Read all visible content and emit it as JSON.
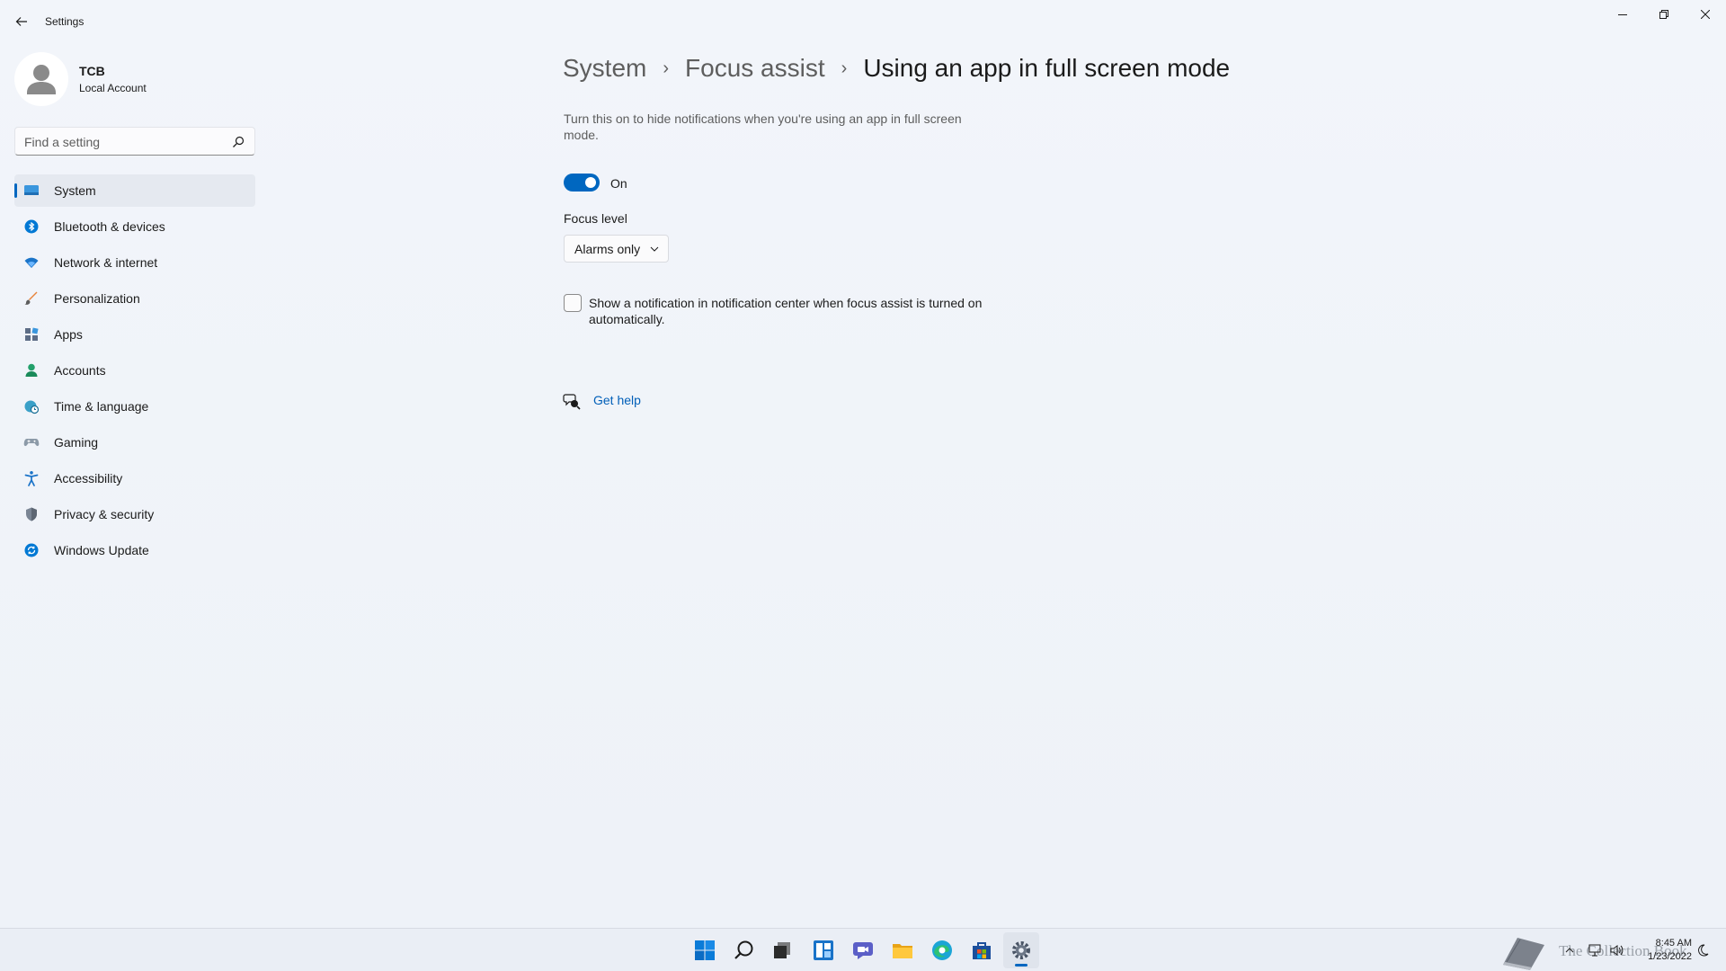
{
  "window": {
    "title": "Settings"
  },
  "profile": {
    "name": "TCB",
    "account_type": "Local Account"
  },
  "search": {
    "placeholder": "Find a setting"
  },
  "sidebar": {
    "items": [
      {
        "label": "System",
        "icon": "monitor-icon",
        "active": true
      },
      {
        "label": "Bluetooth & devices",
        "icon": "bluetooth-icon"
      },
      {
        "label": "Network & internet",
        "icon": "wifi-icon"
      },
      {
        "label": "Personalization",
        "icon": "brush-icon"
      },
      {
        "label": "Apps",
        "icon": "apps-icon"
      },
      {
        "label": "Accounts",
        "icon": "person-icon"
      },
      {
        "label": "Time & language",
        "icon": "globe-clock-icon"
      },
      {
        "label": "Gaming",
        "icon": "gamepad-icon"
      },
      {
        "label": "Accessibility",
        "icon": "accessibility-icon"
      },
      {
        "label": "Privacy & security",
        "icon": "shield-icon"
      },
      {
        "label": "Windows Update",
        "icon": "update-icon"
      }
    ]
  },
  "breadcrumb": {
    "items": [
      "System",
      "Focus assist"
    ],
    "current": "Using an app in full screen mode"
  },
  "main": {
    "description": "Turn this on to hide notifications when you're using an app in full screen mode.",
    "toggle": {
      "state": "On",
      "on": true
    },
    "focus_level": {
      "label": "Focus level",
      "selected": "Alarms only"
    },
    "notification_checkbox": {
      "label": "Show a notification in notification center when focus assist is turned on automatically.",
      "checked": false
    },
    "help": {
      "label": "Get help"
    }
  },
  "taskbar": {
    "apps": [
      "start-icon",
      "search-icon",
      "task-view-icon",
      "widgets-icon",
      "chat-icon",
      "file-explorer-icon",
      "edge-icon",
      "store-icon",
      "settings-icon"
    ],
    "active_app": "settings-icon",
    "clock": {
      "time": "8:45 AM",
      "date": "1/23/2022"
    },
    "watermark": "The Collection Book"
  },
  "colors": {
    "accent": "#0067c0",
    "link": "#005fb8",
    "background": "#eef2f8"
  }
}
